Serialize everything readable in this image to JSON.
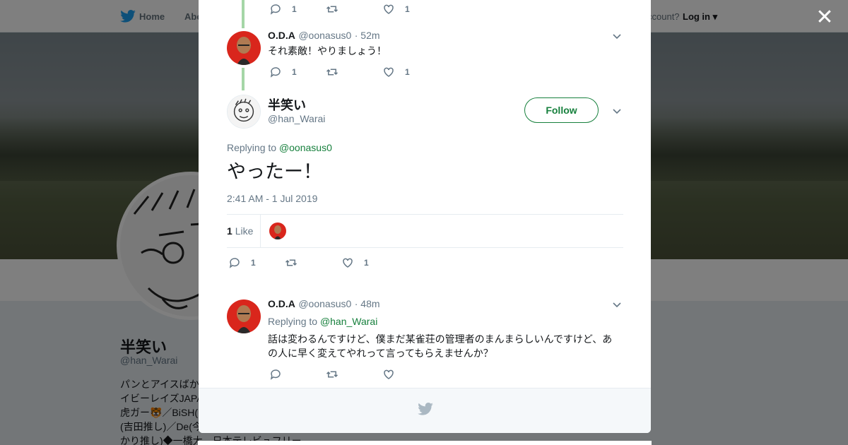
{
  "topbar": {
    "home": "Home",
    "about": "Abo",
    "account": "ccount?",
    "login": "Log in"
  },
  "profile": {
    "name": "半笑い",
    "handle": "@han_Warai",
    "bio_lines": [
      "パンとアイスばか",
      "イビーレイズJAPA",
      "虎ガー🐯／BiSH(",
      "(吉田推し)／De(今",
      "かり推し)◆一橋大→日本テレビュフリー"
    ]
  },
  "thread": {
    "tweet1": {
      "replies": "1",
      "likes": "1"
    },
    "tweet2": {
      "name": "O.D.A",
      "handle": "@oonasus0",
      "time": "· 52m",
      "text": "それ素敵！やりましょう！",
      "replies": "1",
      "likes": "1"
    },
    "main": {
      "name": "半笑い",
      "handle": "@han_Warai",
      "follow": "Follow",
      "replying_prefix": "Replying to",
      "replying_to": "@oonasus0",
      "text": "やったー！",
      "timestamp": "2:41 AM - 1 Jul 2019",
      "like_count": "1",
      "like_label": "Like",
      "replies": "1",
      "likes": "1"
    },
    "tweet3": {
      "name": "O.D.A",
      "handle": "@oonasus0",
      "time": "· 48m",
      "replying_prefix": "Replying to",
      "replying_to": "@han_Warai",
      "text": "話は変わるんですけど、僕まだ某雀荘の管理者のまんまらしいんですけど、あの人に早く変えてやれって言ってもらえませんか？"
    }
  },
  "colors": {
    "accent": "#17803d",
    "thread_line": "#a5d6a7",
    "twitter_blue": "#1da1f2"
  },
  "icons": [
    "twitter-bird-icon",
    "reply-icon",
    "retweet-icon",
    "heart-icon",
    "chevron-down-icon",
    "close-icon"
  ]
}
